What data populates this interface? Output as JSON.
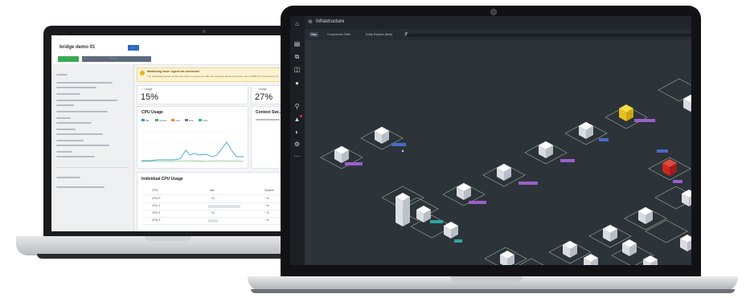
{
  "back_app": {
    "breadcrumb": "··· / ···",
    "title": "bridge demo 01",
    "title_tag": "······",
    "actions": {
      "primary": "···",
      "secondary": "···",
      "tertiary": "··· / ···"
    },
    "warning": {
      "title": "Monitoring Issue: Agent not connected",
      "text": "The Operating System of this host does not appear to offer the expected Monitoring Probe. Run SNMP Port Connection on..."
    },
    "cards": [
      {
        "label": "··· Usage",
        "value": "15%"
      },
      {
        "label": "··· Usage",
        "value": "27%"
      }
    ],
    "cpu_chart": {
      "title": "CPU Usage",
      "legend": [
        "Idle",
        "System",
        "User",
        "Nice",
        "Total"
      ],
      "colors": [
        "#3a8bd6",
        "#4cb050",
        "#e38d2b",
        "#8a5cc7",
        "#34b6b0"
      ],
      "line_color": "#3ea3d6"
    },
    "context_panel": {
      "title": "Context Swi..."
    },
    "individual_cpu": {
      "title": "Individual CPU Usage",
      "headers": [
        "CPU",
        "Idle",
        "System"
      ],
      "rows": [
        [
          "CPU 0",
          "··%",
          "··%"
        ],
        [
          "CPU 1",
          "··%",
          "··%"
        ],
        [
          "CPU 2",
          "··%",
          "··%"
        ],
        [
          "CPU 3",
          "··%",
          "··%"
        ]
      ]
    }
  },
  "front_app": {
    "title": "Infrastructure",
    "tabs": [
      "Map",
      "Components Table",
      "Entity Explorer (Beta)"
    ],
    "active_tab": "Map",
    "map": {
      "highlight_colors": {
        "warning": "#e6c21f",
        "critical": "#c6281f"
      },
      "label_colors": {
        "blue": "#4d68c9",
        "purple": "#9b5fc9",
        "teal": "#2fa8a0",
        "green": "#3fae5a"
      }
    }
  }
}
